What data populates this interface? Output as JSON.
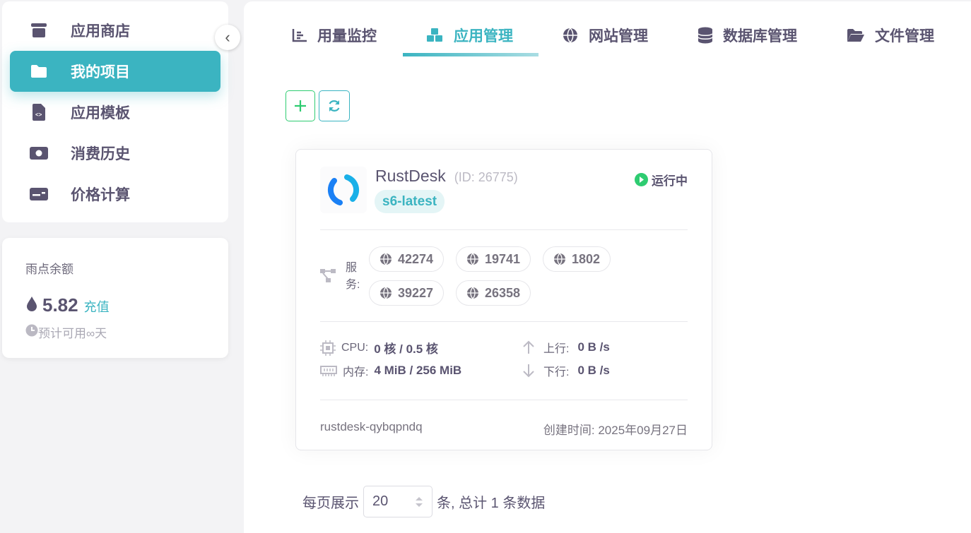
{
  "sidebar": {
    "items": [
      {
        "label": "应用商店",
        "icon": "store-icon"
      },
      {
        "label": "我的项目",
        "icon": "folder-icon"
      },
      {
        "label": "应用模板",
        "icon": "file-code-icon"
      },
      {
        "label": "消费历史",
        "icon": "money-icon"
      },
      {
        "label": "价格计算",
        "icon": "calculator-icon"
      }
    ],
    "active": 1
  },
  "balance": {
    "title": "雨点余额",
    "amount": "5.82",
    "recharge": "充值",
    "estimate": "预计可用∞天"
  },
  "tabs": [
    {
      "label": "用量监控"
    },
    {
      "label": "应用管理"
    },
    {
      "label": "网站管理"
    },
    {
      "label": "数据库管理"
    },
    {
      "label": "文件管理"
    }
  ],
  "app": {
    "name": "RustDesk",
    "id": "(ID: 26775)",
    "tag": "s6-latest",
    "status": "运行中",
    "services_label": "服务:",
    "ports": [
      "42274",
      "19741",
      "1802",
      "39227",
      "26358"
    ],
    "cpu_label": "CPU:",
    "cpu": "0 核 / 0.5 核",
    "mem_label": "内存:",
    "mem": "4 MiB / 256 MiB",
    "up_label": "上行:",
    "up": "0 B /s",
    "down_label": "下行:",
    "down": "0 B /s",
    "slug": "rustdesk-qybqpndq",
    "created": "创建时间: 2025年09月27日"
  },
  "pagination": {
    "prefix": "每页展示",
    "page_size": "20",
    "suffix": "条, 总计 1 条数据"
  },
  "colors": {
    "accent": "#3bb4c1",
    "running": "#2ecc71"
  }
}
